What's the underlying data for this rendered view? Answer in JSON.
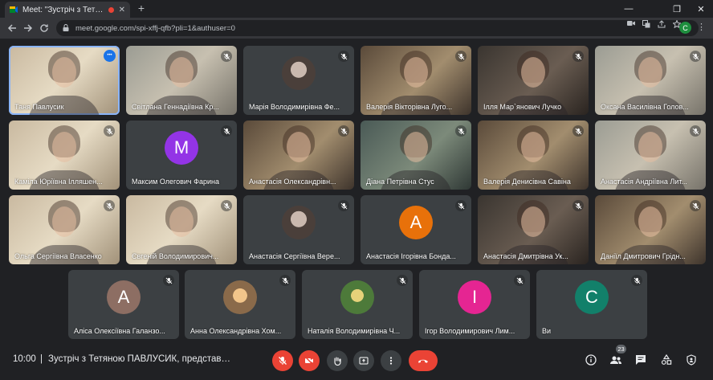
{
  "browser": {
    "tab_title": "Meet: \"Зустріч з Тетяною П",
    "tab_close": "✕",
    "new_tab": "+",
    "url": "meet.google.com/spi-xffj-qfb?pli=1&authuser=0",
    "profile_initial": "C",
    "window_controls": [
      "—",
      "❐",
      "✕"
    ],
    "icons": [
      "back-arrow-icon",
      "forward-arrow-icon",
      "reload-icon",
      "lock-icon",
      "camera-icon",
      "translate-icon",
      "share-icon",
      "star-icon",
      "menu-icon"
    ]
  },
  "tiles": [
    {
      "name": "Таня Павлусик",
      "kind": "video",
      "variant": "v4",
      "speaking": true
    },
    {
      "name": "Світлана Геннадіївна Кр...",
      "kind": "video",
      "variant": "v2"
    },
    {
      "name": "Марія Володимирівна Фе...",
      "kind": "photo",
      "photo": "portrait"
    },
    {
      "name": "Валерія Вікторівна Луго...",
      "kind": "video",
      "variant": "v3"
    },
    {
      "name": "Ілля Мар`янович Лучко",
      "kind": "video",
      "variant": "v6"
    },
    {
      "name": "Оксана Василівна Голов...",
      "kind": "video",
      "variant": "v2"
    },
    {
      "name": "Каміла Юріївна Ілляшен...",
      "kind": "video",
      "variant": "v4"
    },
    {
      "name": "Максим Олегович Фарина",
      "kind": "avatar",
      "initial": "M",
      "color": "#9334e6"
    },
    {
      "name": "Анастасія Олександрівн...",
      "kind": "video",
      "variant": "v3"
    },
    {
      "name": "Діана Петрівна Стус",
      "kind": "video",
      "variant": "v5"
    },
    {
      "name": "Валерія Денисівна Савіна",
      "kind": "video",
      "variant": "v3"
    },
    {
      "name": "Анастасія Андріївна Лит...",
      "kind": "video",
      "variant": "v2"
    },
    {
      "name": "Ольга Сергіївна Власенко",
      "kind": "video",
      "variant": "v4"
    },
    {
      "name": "Євгеній Володимирович...",
      "kind": "video",
      "variant": "v4"
    },
    {
      "name": "Анастасія Сергіївна Вере...",
      "kind": "photo",
      "photo": "portrait"
    },
    {
      "name": "Анастасія Ігорівна Бонда...",
      "kind": "avatar",
      "initial": "A",
      "color": "#e8710a"
    },
    {
      "name": "Анастасія Дмитрівна Ук...",
      "kind": "video",
      "variant": "v6"
    },
    {
      "name": "Даніїл Дмитрович Грідн...",
      "kind": "video",
      "variant": "v3"
    },
    {
      "name": "Аліса Олексіївна Галанзо...",
      "kind": "avatar",
      "initial": "A",
      "color": "#8d6e63"
    },
    {
      "name": "Анна Олександрівна Хом...",
      "kind": "photo",
      "photo": "sunset"
    },
    {
      "name": "Наталія Володимирівна Ч...",
      "kind": "photo",
      "photo": "nature"
    },
    {
      "name": "Ігор Володимирович Лим...",
      "kind": "avatar",
      "initial": "І",
      "color": "#e52592"
    },
    {
      "name": "Ви",
      "kind": "avatar",
      "initial": "C",
      "color": "#12806a"
    }
  ],
  "bottom": {
    "time": "10:00",
    "separator": "|",
    "meeting_title": "Зустріч з Тетяною ПАВЛУСИК, представниц...",
    "participant_count": "23"
  },
  "colors": {
    "background": "#202124",
    "tile": "#3c4043",
    "danger": "#ea4335",
    "accent": "#8ab4f8"
  }
}
